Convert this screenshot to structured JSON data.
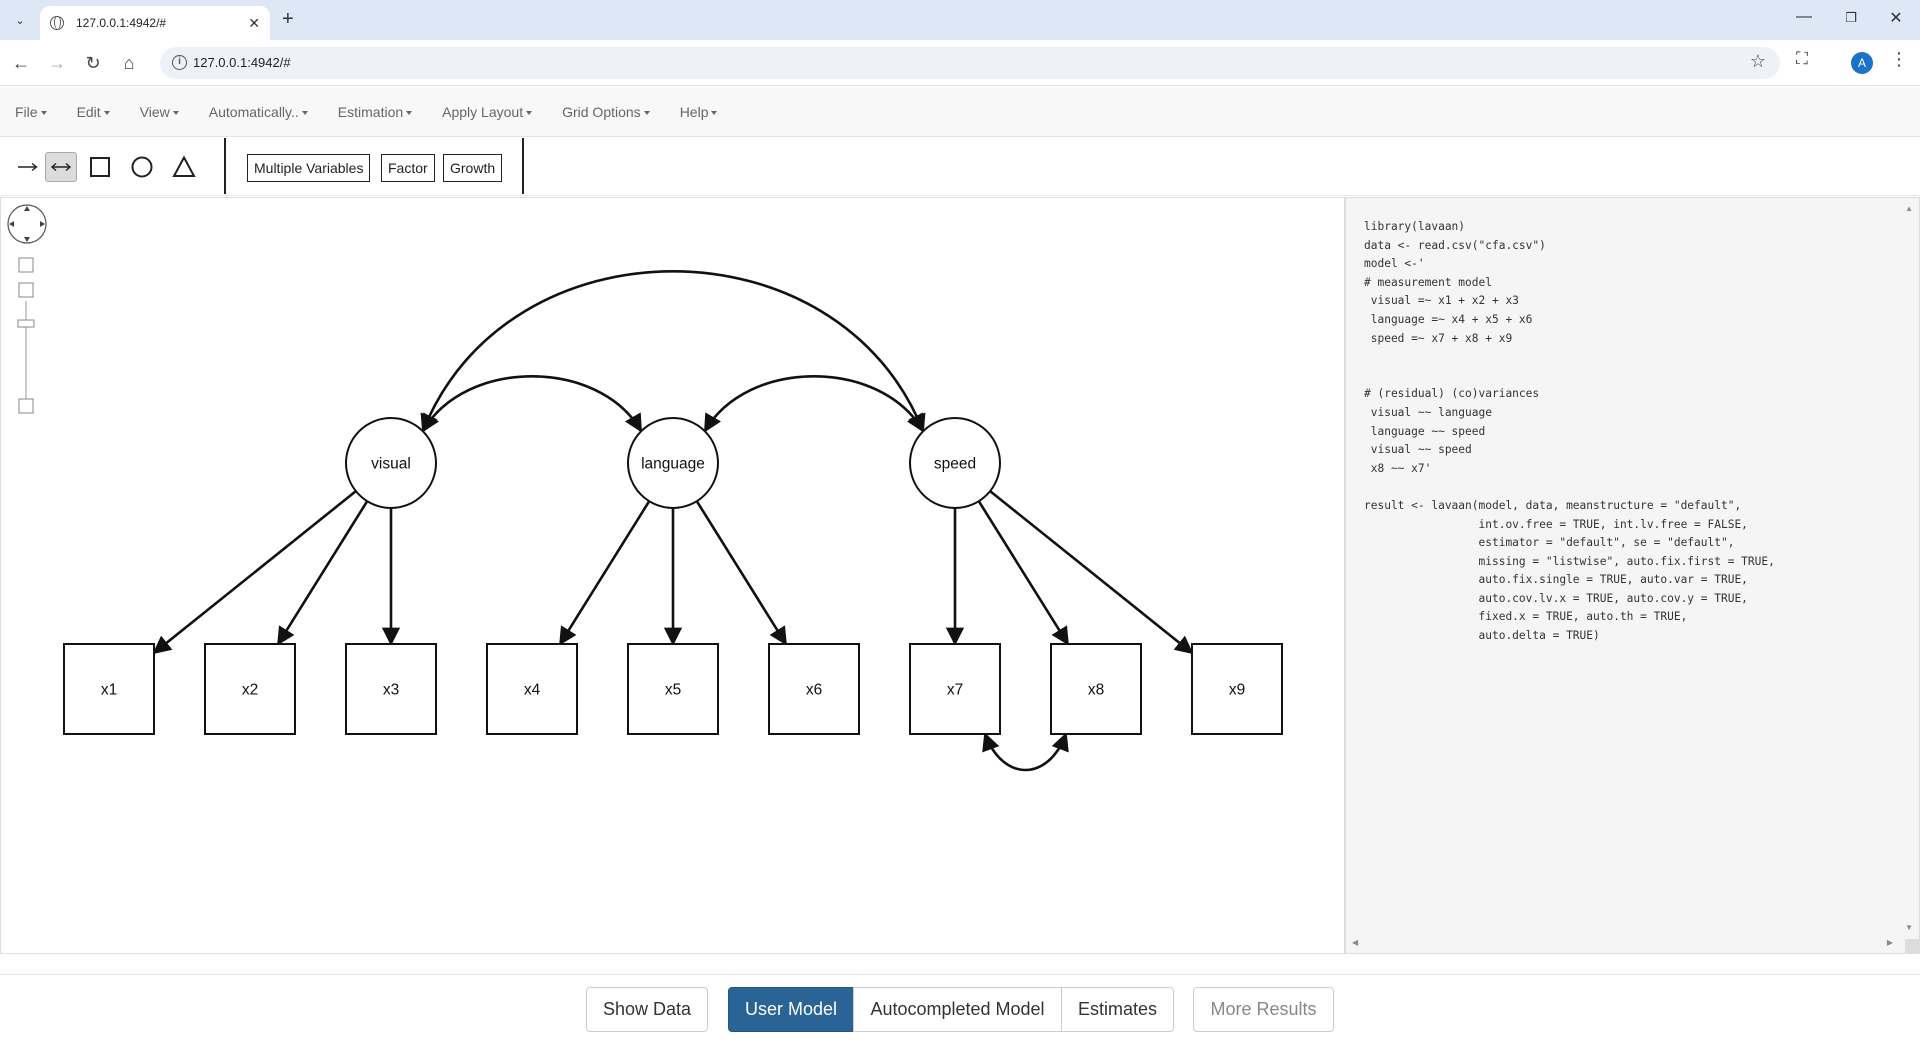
{
  "browser": {
    "tab_title": "127.0.0.1:4942/#",
    "url": "127.0.0.1:4942/#",
    "profile_initial": "A"
  },
  "menu": [
    {
      "label": "File"
    },
    {
      "label": "Edit"
    },
    {
      "label": "View"
    },
    {
      "label": "Automatically.."
    },
    {
      "label": "Estimation"
    },
    {
      "label": "Apply Layout"
    },
    {
      "label": "Grid Options"
    },
    {
      "label": "Help"
    }
  ],
  "tools": {
    "active": "covariance-arrow",
    "buttons": [
      "Multiple Variables",
      "Factor",
      "Growth"
    ]
  },
  "diagram": {
    "latent": [
      {
        "id": "visual",
        "label": "visual"
      },
      {
        "id": "language",
        "label": "language"
      },
      {
        "id": "speed",
        "label": "speed"
      }
    ],
    "observed": [
      {
        "id": "x1",
        "label": "x1",
        "factor": "visual"
      },
      {
        "id": "x2",
        "label": "x2",
        "factor": "visual"
      },
      {
        "id": "x3",
        "label": "x3",
        "factor": "visual"
      },
      {
        "id": "x4",
        "label": "x4",
        "factor": "language"
      },
      {
        "id": "x5",
        "label": "x5",
        "factor": "language"
      },
      {
        "id": "x6",
        "label": "x6",
        "factor": "language"
      },
      {
        "id": "x7",
        "label": "x7",
        "factor": "speed"
      },
      {
        "id": "x8",
        "label": "x8",
        "factor": "speed"
      },
      {
        "id": "x9",
        "label": "x9",
        "factor": "speed"
      }
    ],
    "covariances": [
      [
        "visual",
        "language"
      ],
      [
        "language",
        "speed"
      ],
      [
        "visual",
        "speed"
      ],
      [
        "x7",
        "x8"
      ]
    ]
  },
  "code_lines": [
    "library(lavaan)",
    "data <- read.csv(\"cfa.csv\")",
    "model <-'",
    "# measurement model",
    " visual =~ x1 + x2 + x3",
    " language =~ x4 + x5 + x6",
    " speed =~ x7 + x8 + x9",
    "",
    "",
    "# (residual) (co)variances",
    " visual ~~ language",
    " language ~~ speed",
    " visual ~~ speed",
    " x8 ~~ x7'",
    "",
    "result <- lavaan(model, data, meanstructure = \"default\",",
    "                 int.ov.free = TRUE, int.lv.free = FALSE,",
    "                 estimator = \"default\", se = \"default\",",
    "                 missing = \"listwise\", auto.fix.first = TRUE,",
    "                 auto.fix.single = TRUE, auto.var = TRUE,",
    "                 auto.cov.lv.x = TRUE, auto.cov.y = TRUE,",
    "                 fixed.x = TRUE, auto.th = TRUE,",
    "                 auto.delta = TRUE)"
  ],
  "bottom_tabs": {
    "show_data": "Show Data",
    "user_model": "User Model",
    "autocompleted_model": "Autocompleted Model",
    "estimates": "Estimates",
    "more_results": "More Results"
  }
}
